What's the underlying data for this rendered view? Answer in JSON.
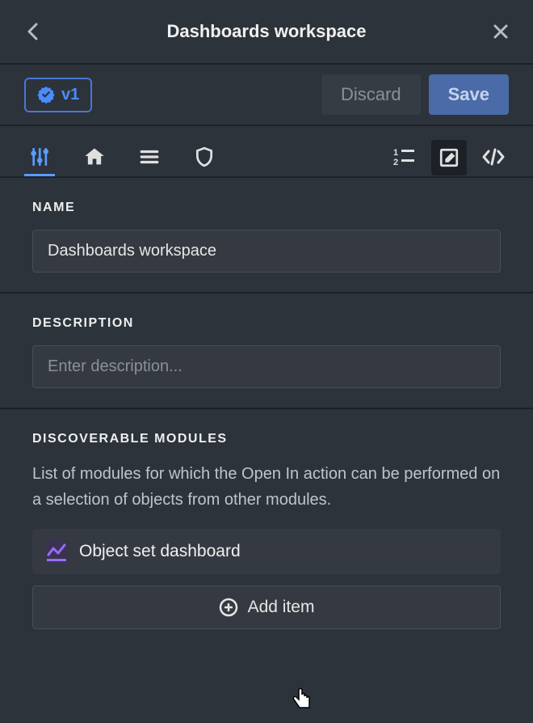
{
  "header": {
    "title": "Dashboards workspace"
  },
  "action_bar": {
    "version": "v1",
    "discard_label": "Discard",
    "save_label": "Save"
  },
  "sections": {
    "name": {
      "label": "NAME",
      "value": "Dashboards workspace"
    },
    "description": {
      "label": "DESCRIPTION",
      "placeholder": "Enter description..."
    },
    "discoverable_modules": {
      "label": "DISCOVERABLE MODULES",
      "helper": "List of modules for which the Open In action can be performed on a selection of objects from other modules.",
      "items": [
        {
          "label": "Object set dashboard"
        }
      ],
      "add_item_label": "Add item"
    }
  }
}
